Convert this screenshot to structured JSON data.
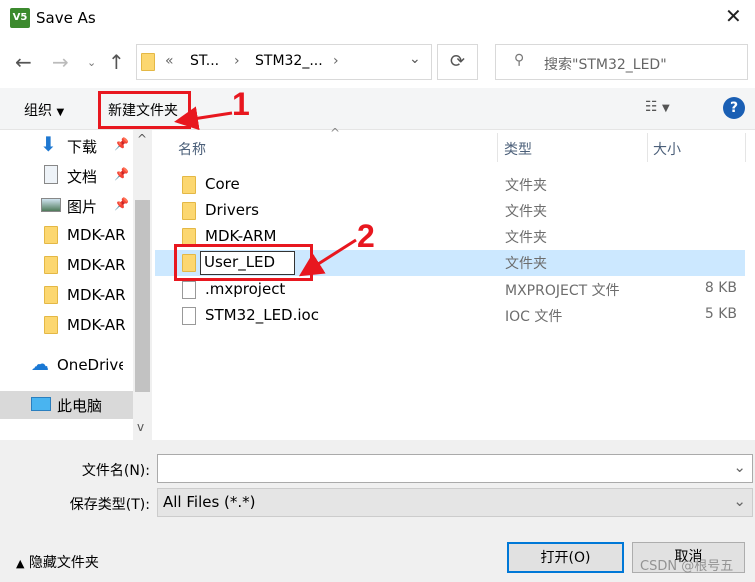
{
  "window": {
    "title": "Save As",
    "app_icon": "V5"
  },
  "nav": {
    "breadcrumb": [
      "«",
      "ST...",
      "STM32_..."
    ],
    "search_placeholder": "搜索\"STM32_LED\""
  },
  "toolbar": {
    "organize": "组织",
    "new_folder": "新建文件夹"
  },
  "sidebar": {
    "items": [
      {
        "label": "下载",
        "icon": "download-icon",
        "pinned": true
      },
      {
        "label": "文档",
        "icon": "document-icon",
        "pinned": true
      },
      {
        "label": "图片",
        "icon": "pictures-icon",
        "pinned": true
      },
      {
        "label": "MDK-AR",
        "icon": "folder-icon"
      },
      {
        "label": "MDK-AR",
        "icon": "folder-icon"
      },
      {
        "label": "MDK-AR",
        "icon": "folder-icon"
      },
      {
        "label": "MDK-AR",
        "icon": "folder-icon"
      },
      {
        "label": "OneDrive",
        "icon": "cloud-icon"
      },
      {
        "label": "此电脑",
        "icon": "computer-icon",
        "selected": true
      }
    ]
  },
  "columns": {
    "name": "名称",
    "type": "类型",
    "size": "大小"
  },
  "files": [
    {
      "name": "Core",
      "type": "文件夹",
      "size": "",
      "kind": "folder"
    },
    {
      "name": "Drivers",
      "type": "文件夹",
      "size": "",
      "kind": "folder"
    },
    {
      "name": "MDK-ARM",
      "type": "文件夹",
      "size": "",
      "kind": "folder"
    },
    {
      "name": "User_LED",
      "type": "文件夹",
      "size": "",
      "kind": "folder",
      "editing": true
    },
    {
      "name": ".mxproject",
      "type": "MXPROJECT 文件",
      "size": "8 KB",
      "kind": "file"
    },
    {
      "name": "STM32_LED.ioc",
      "type": "IOC 文件",
      "size": "5 KB",
      "kind": "file"
    }
  ],
  "form": {
    "filename_label": "文件名(N):",
    "filename_value": "",
    "filetype_label": "保存类型(T):",
    "filetype_value": "All Files (*.*)"
  },
  "buttons": {
    "open": "打开(O)",
    "cancel": "取消",
    "hide_folders": "隐藏文件夹"
  },
  "annotations": {
    "step1": "1",
    "step2": "2",
    "color": "#e8171f"
  },
  "watermark": "CSDN @根号五"
}
